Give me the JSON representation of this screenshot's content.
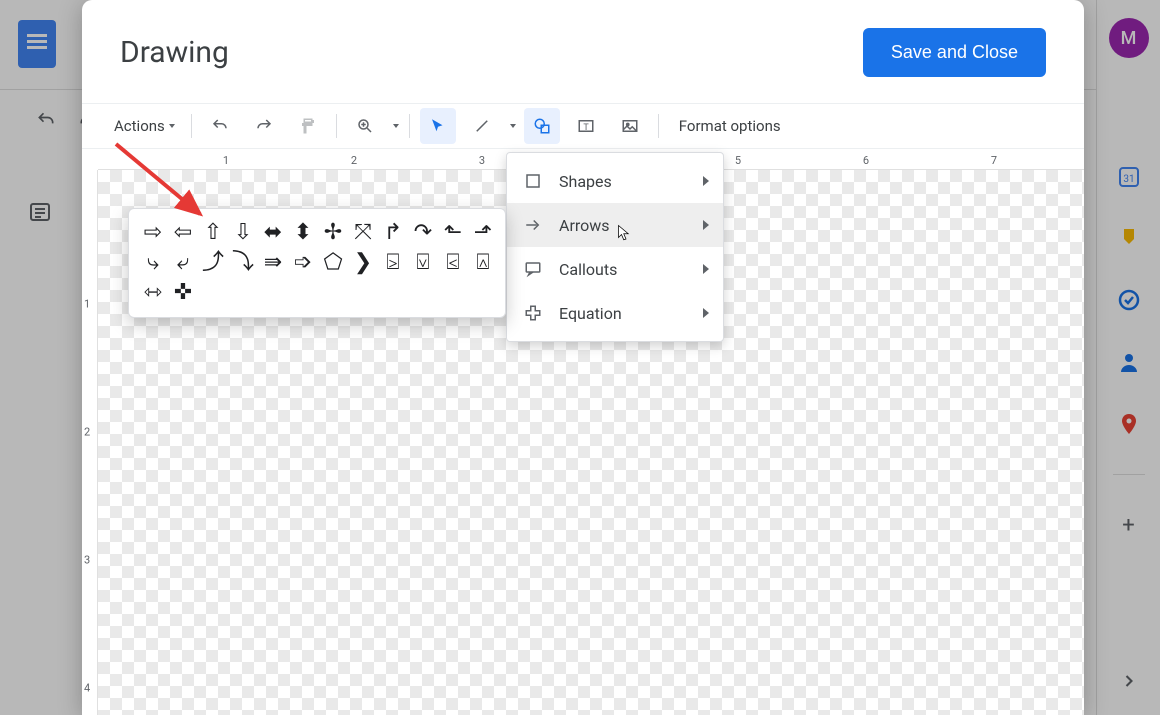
{
  "background": {
    "app_name": "Google Docs",
    "avatar_initial": "M",
    "left_outline_tooltip": "Document outline"
  },
  "modal": {
    "title": "Drawing",
    "save_label": "Save and Close",
    "actions_label": "Actions",
    "format_options_label": "Format options"
  },
  "shape_menu": {
    "items": [
      {
        "label": "Shapes",
        "icon": "square-icon"
      },
      {
        "label": "Arrows",
        "icon": "arrow-right-icon"
      },
      {
        "label": "Callouts",
        "icon": "callout-icon"
      },
      {
        "label": "Equation",
        "icon": "plus-shape-icon"
      }
    ],
    "highlighted_index": 1
  },
  "ruler": {
    "h_labels": [
      "1",
      "2",
      "3",
      "4",
      "5",
      "6",
      "7"
    ],
    "v_labels": [
      "1",
      "2",
      "3",
      "4"
    ]
  },
  "arrow_palette": {
    "items": [
      "right-arrow",
      "left-arrow",
      "up-arrow",
      "down-arrow",
      "left-right-arrow",
      "up-down-arrow",
      "quad-arrow",
      "left-right-up-arrow",
      "bent-arrow",
      "u-turn-arrow",
      "left-up-arrow",
      "bent-up-arrow",
      "curved-right-arrow",
      "curved-left-arrow",
      "curved-up-arrow",
      "curved-down-arrow",
      "striped-right-arrow",
      "notched-right-arrow",
      "pentagon-arrow",
      "chevron-arrow",
      "right-callout-arrow",
      "down-callout-arrow",
      "left-callout-arrow",
      "up-callout-arrow",
      "left-right-callout-arrow",
      "quad-callout-arrow"
    ]
  }
}
